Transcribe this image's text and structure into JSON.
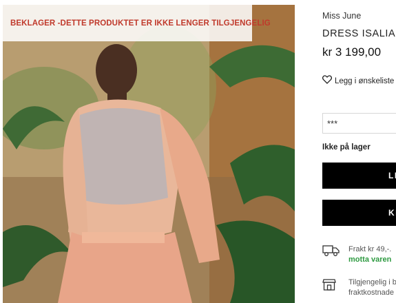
{
  "banner": {
    "text": "BEKLAGER -DETTE PRODUKTET ER IKKE LENGER TILGJENGELIG",
    "color": "#c0392b"
  },
  "product": {
    "brand": "Miss June",
    "name": "DRESS ISALIA",
    "price": "kr 3 199,00",
    "wishlist_label": "Legg i ønskeliste",
    "size_select_value": "***",
    "stock_status": "Ikke på lager",
    "button_primary_label": "LE",
    "button_secondary_label": "KL"
  },
  "info": {
    "shipping_line1": "Frakt kr 49,-.",
    "shipping_line2": "motta varen",
    "store_line1": "Tilgjengelig i b",
    "store_line2": "fraktkostnade"
  },
  "icons": [
    "heart-icon",
    "truck-icon",
    "store-icon"
  ],
  "colors": {
    "accent_green": "#2e9a41",
    "button_bg": "#000000"
  }
}
